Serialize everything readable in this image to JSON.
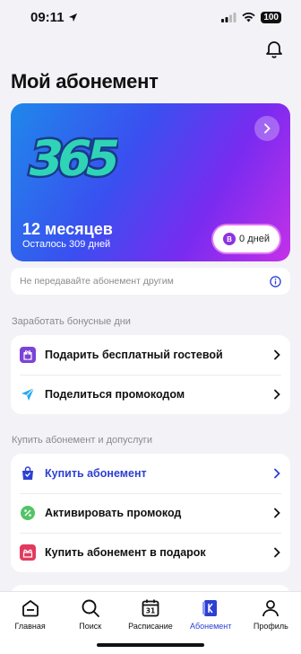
{
  "status_bar": {
    "time": "09:11",
    "battery": "100"
  },
  "page_title": "Мой абонемент",
  "card": {
    "logo_text": "365",
    "title": "12 месяцев",
    "subtitle": "Осталось 309 дней",
    "bonus_letter": "В",
    "bonus_label": "0 дней"
  },
  "notice": {
    "text": "Не передавайте абонемент другим"
  },
  "bonus_section": {
    "label": "Заработать бонусные дни",
    "items": [
      {
        "label": "Подарить бесплатный гостевой",
        "icon": "gift-ticket-icon"
      },
      {
        "label": "Поделиться промокодом",
        "icon": "send-icon"
      }
    ]
  },
  "buy_section": {
    "label": "Купить абонемент и допуслуги",
    "items": [
      {
        "label": "Купить абонемент",
        "icon": "shopping-bag-icon"
      },
      {
        "label": "Активировать промокод",
        "icon": "percent-icon"
      },
      {
        "label": "Купить абонемент в подарок",
        "icon": "gift-icon"
      }
    ]
  },
  "tabs": [
    {
      "label": "Главная",
      "icon": "home-icon"
    },
    {
      "label": "Поиск",
      "icon": "search-icon"
    },
    {
      "label": "Расписание",
      "icon": "calendar-icon",
      "day": "31"
    },
    {
      "label": "Абонемент",
      "icon": "membership-card-icon",
      "active": true
    },
    {
      "label": "Профиль",
      "icon": "profile-icon"
    }
  ],
  "colors": {
    "accent": "#2d3fd3",
    "card_gradient_start": "#1f88ea",
    "card_gradient_end": "#c431e8",
    "bonus_purple": "#8b34e0"
  }
}
